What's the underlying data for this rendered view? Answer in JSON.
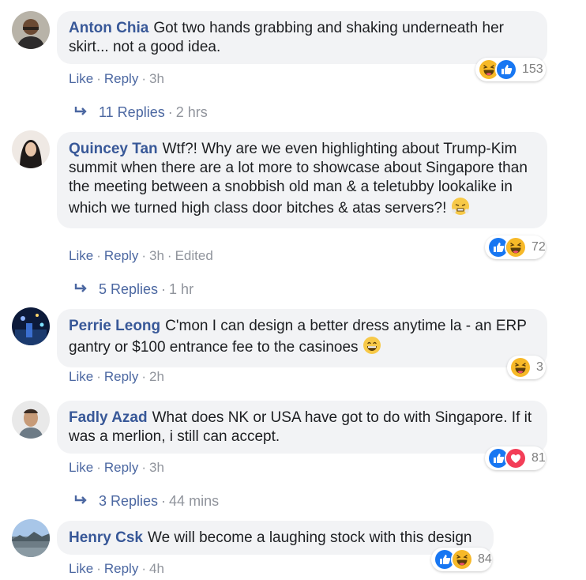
{
  "comments": [
    {
      "author": "Anton Chia",
      "text": "Got two hands grabbing and shaking underneath her skirt... not a good idea.",
      "actions": {
        "like": "Like",
        "reply": "Reply",
        "time": "3h"
      },
      "reactions": {
        "icons": [
          "haha-icon",
          "like-icon"
        ],
        "count": "153"
      },
      "replies": {
        "label": "11 Replies",
        "time": "2 hrs"
      }
    },
    {
      "author": "Quincey Tan",
      "text": "Wtf?! Why are we even highlighting about Trump-Kim summit when there are a lot more to showcase about Singapore than the meeting between a snobbish old man & a teletubby lookalike in which we turned high class door bitches & atas servers?!",
      "actions": {
        "like": "Like",
        "reply": "Reply",
        "time": "3h",
        "edited": "Edited"
      },
      "reactions": {
        "icons": [
          "like-icon",
          "haha-icon"
        ],
        "count": "72"
      },
      "replies": {
        "label": "5 Replies",
        "time": "1 hr"
      }
    },
    {
      "author": "Perrie Leong",
      "text": "C'mon I can design a better dress anytime la - an ERP gantry or $100 entrance fee to the casinoes",
      "actions": {
        "like": "Like",
        "reply": "Reply",
        "time": "2h"
      },
      "reactions": {
        "icons": [
          "haha-icon"
        ],
        "count": "3"
      }
    },
    {
      "author": "Fadly Azad",
      "text": "What does NK or USA have got to do with Singapore. If it was a merlion, i still can accept.",
      "actions": {
        "like": "Like",
        "reply": "Reply",
        "time": "3h"
      },
      "reactions": {
        "icons": [
          "like-icon",
          "love-icon"
        ],
        "count": "81"
      },
      "replies": {
        "label": "3 Replies",
        "time": "44 mins"
      }
    },
    {
      "author": "Henry Csk",
      "text": "We will become a laughing stock with this design",
      "actions": {
        "like": "Like",
        "reply": "Reply",
        "time": "4h"
      },
      "reactions": {
        "icons": [
          "like-icon",
          "haha-icon"
        ],
        "count": "84"
      }
    }
  ],
  "separator": "·",
  "colors": {
    "link": "#385898",
    "muted": "#90949c",
    "bubble": "#f2f3f5",
    "like": "#1877f2",
    "love": "#f33e58",
    "haha": "#f7b928"
  }
}
